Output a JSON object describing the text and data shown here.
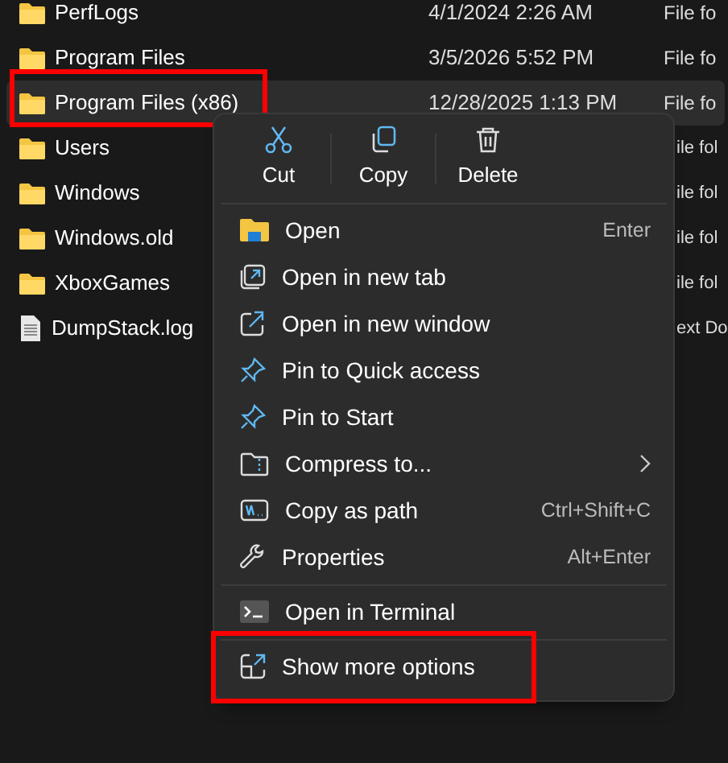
{
  "files": [
    {
      "name": "PerfLogs",
      "date": "4/1/2024 2:26 AM",
      "type": "File fo",
      "kind": "folder",
      "selected": false,
      "highlighted": false
    },
    {
      "name": "Program Files",
      "date": "3/5/2026 5:52 PM",
      "type": "File fo",
      "kind": "folder",
      "selected": false,
      "highlighted": false
    },
    {
      "name": "Program Files (x86)",
      "date": "12/28/2025 1:13 PM",
      "type": "File fo",
      "kind": "folder",
      "selected": true,
      "highlighted": true
    },
    {
      "name": "Users",
      "type": "ile fol",
      "kind": "folder",
      "selected": false,
      "highlighted": false
    },
    {
      "name": "Windows",
      "type": "ile fol",
      "kind": "folder",
      "selected": false,
      "highlighted": false
    },
    {
      "name": "Windows.old",
      "type": "ile fol",
      "kind": "folder",
      "selected": false,
      "highlighted": false
    },
    {
      "name": "XboxGames",
      "type": "ile fol",
      "kind": "folder",
      "selected": false,
      "highlighted": false
    },
    {
      "name": "DumpStack.log",
      "type": "ext Do",
      "kind": "file",
      "selected": false,
      "highlighted": false
    }
  ],
  "context_menu": {
    "toolbar": [
      {
        "label": "Cut",
        "kind": "cut"
      },
      {
        "label": "Copy",
        "kind": "copy"
      },
      {
        "label": "Delete",
        "kind": "delete"
      }
    ],
    "groups": [
      [
        {
          "label": "Open",
          "kind": "open",
          "shortcut": "Enter",
          "highlighted": false
        },
        {
          "label": "Open in new tab",
          "kind": "newtab",
          "highlighted": false
        },
        {
          "label": "Open in new window",
          "kind": "newwindow",
          "highlighted": false
        },
        {
          "label": "Pin to Quick access",
          "kind": "pin",
          "highlighted": false
        },
        {
          "label": "Pin to Start",
          "kind": "pin",
          "highlighted": false
        },
        {
          "label": "Compress to...",
          "kind": "compress",
          "submenu": true,
          "highlighted": false
        },
        {
          "label": "Copy as path",
          "kind": "path",
          "shortcut": "Ctrl+Shift+C",
          "highlighted": false
        },
        {
          "label": "Properties",
          "kind": "wrench",
          "shortcut": "Alt+Enter",
          "highlighted": false
        }
      ],
      [
        {
          "label": "Open in Terminal",
          "kind": "terminal",
          "highlighted": false
        }
      ],
      [
        {
          "label": "Show more options",
          "kind": "more",
          "highlighted": true
        }
      ]
    ]
  }
}
